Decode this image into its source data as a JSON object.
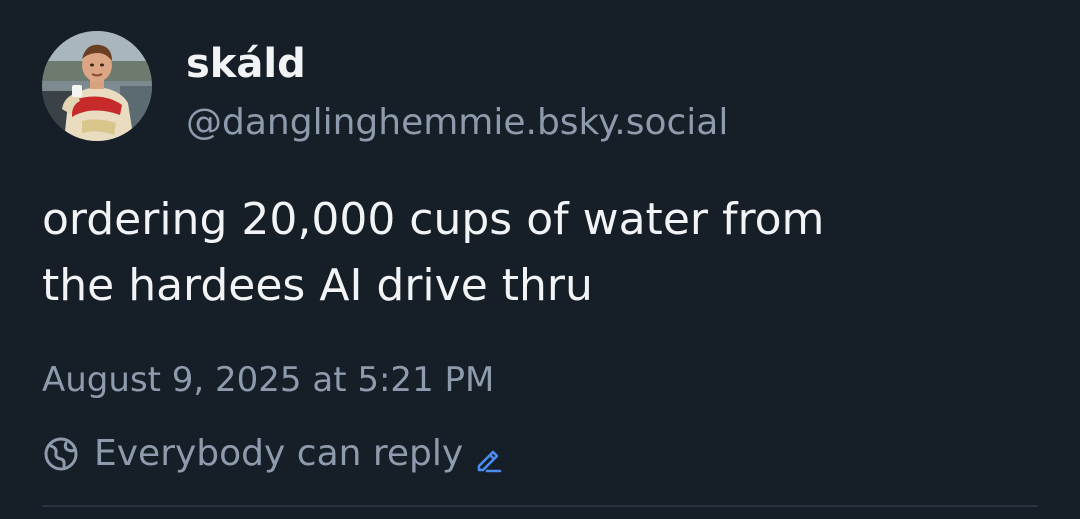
{
  "post": {
    "author": {
      "display_name": "skáld",
      "handle": "@danglinghemmie.bsky.social"
    },
    "text_lines": [
      "ordering 20,000 cups of water from",
      "the hardees AI drive thru"
    ],
    "timestamp": "August 9, 2025 at 5:21 PM",
    "reply_setting": "Everybody can reply"
  },
  "icons": {
    "reply_setting_icon": "globe-icon",
    "edit_icon": "pencil-edit-icon"
  },
  "colors": {
    "background": "#161e27",
    "primary_text": "#f1f3f5",
    "secondary_text": "#8d9bad",
    "accent": "#4a8cf0",
    "divider": "#26323e"
  }
}
